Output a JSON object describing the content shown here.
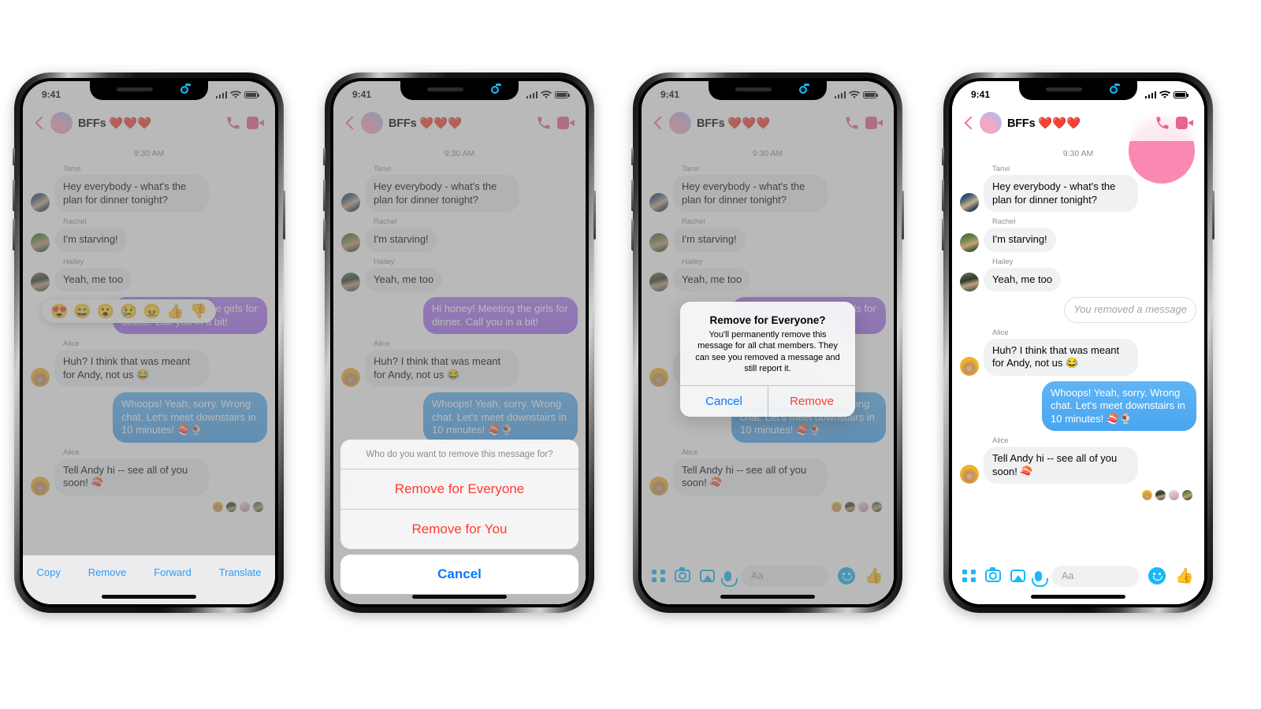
{
  "status_bar": {
    "time": "9:41"
  },
  "header": {
    "title": "BFFs ❤️❤️❤️",
    "back_icon": "chevron-left-icon",
    "call_icon": "phone-icon",
    "video_icon": "video-camera-icon"
  },
  "thread": {
    "timestamp": "9:30 AM",
    "messages": [
      {
        "sender": "Tanvi",
        "text": "Hey everybody - what's the plan for dinner tonight?",
        "side": "in",
        "style": "gray",
        "avatar": "tanvi"
      },
      {
        "sender": "Rachel",
        "text": "I'm starving!",
        "side": "in",
        "style": "gray",
        "avatar": "rachel"
      },
      {
        "sender": "Hailey",
        "text": "Yeah, me too",
        "side": "in",
        "style": "gray",
        "avatar": "hailey"
      },
      {
        "sender": "",
        "text": "Hi honey! Meeting the girls for dinner. Call you in a bit!",
        "side": "out",
        "style": "purple",
        "avatar": ""
      },
      {
        "sender": "Alice",
        "text": "Huh? I think that was meant for Andy, not us 😂",
        "side": "in",
        "style": "gray",
        "avatar": "alice"
      },
      {
        "sender": "",
        "text": "Whoops! Yeah, sorry. Wrong chat. Let's meet downstairs in 10 minutes! 🍣🍨",
        "side": "out",
        "style": "blue",
        "avatar": ""
      },
      {
        "sender": "Alice",
        "text": "Tell Andy hi -- see all of you soon! 🍣",
        "side": "in",
        "style": "gray",
        "avatar": "alice"
      }
    ],
    "removed_placeholder": "You removed a message"
  },
  "composer": {
    "placeholder": "Aa",
    "icons": [
      "apps-grid-icon",
      "camera-icon",
      "photo-icon",
      "microphone-icon",
      "emoji-smiley-icon",
      "thumbs-up-icon"
    ]
  },
  "reaction_tray": {
    "emojis": [
      "😍",
      "😄",
      "😮",
      "😢",
      "😠",
      "👍",
      "👎"
    ]
  },
  "context_menu": {
    "items": [
      "Copy",
      "Remove",
      "Forward",
      "Translate"
    ]
  },
  "action_sheet": {
    "title": "Who do you want to remove this message for?",
    "options": [
      "Remove for Everyone",
      "Remove for You"
    ],
    "cancel": "Cancel"
  },
  "alert": {
    "title": "Remove for Everyone?",
    "message": "You'll permanently remove this message for all chat members. They can see you removed a message and still report it.",
    "cancel": "Cancel",
    "confirm": "Remove"
  },
  "colors": {
    "accent_blue": "#2e9bf7",
    "destructive_red": "#ff3b30",
    "messenger_blue": "#17b9f7",
    "bubble_purple": "#a56ff2",
    "bubble_blue": "#4aa6f0",
    "bubble_gray": "#eff1f3",
    "header_pink": "#e9648f"
  }
}
